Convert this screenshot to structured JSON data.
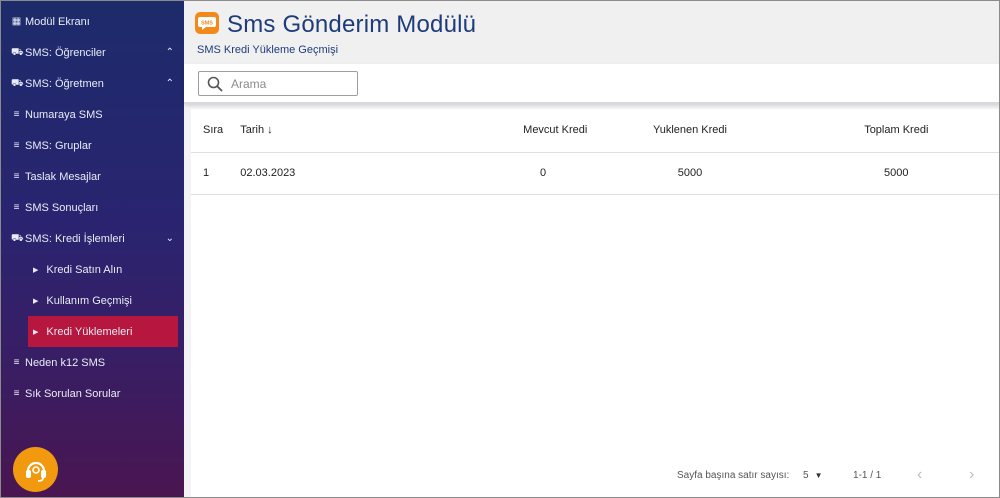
{
  "sidebar": {
    "items": [
      {
        "icon": "grid-icon",
        "glyph": "▦",
        "label": "Modül Ekranı"
      },
      {
        "icon": "truck-icon",
        "glyph": "⛟",
        "label": "SMS: Öğrenciler",
        "chevron": "⌃"
      },
      {
        "icon": "truck-icon",
        "glyph": "⛟",
        "label": "SMS: Öğretmen",
        "chevron": "⌃"
      },
      {
        "icon": "list-icon",
        "glyph": "≡",
        "label": "Numaraya SMS"
      },
      {
        "icon": "list-icon",
        "glyph": "≡",
        "label": "SMS: Gruplar"
      },
      {
        "icon": "list-icon",
        "glyph": "≡",
        "label": "Taslak Mesajlar"
      },
      {
        "icon": "list-icon",
        "glyph": "≡",
        "label": "SMS Sonuçları"
      },
      {
        "icon": "truck-icon",
        "glyph": "⛟",
        "label": "SMS: Kredi İşlemleri",
        "chevron": "⌄"
      }
    ],
    "subitems": [
      {
        "label": "Kredi Satın Alın"
      },
      {
        "label": "Kullanım Geçmişi"
      },
      {
        "label": "Kredi Yüklemeleri",
        "active": true
      }
    ],
    "bottom_items": [
      {
        "icon": "list-icon",
        "glyph": "≡",
        "label": "Neden k12 SMS"
      },
      {
        "icon": "list-icon",
        "glyph": "≡",
        "label": "Sık Sorulan Sorular"
      }
    ]
  },
  "header": {
    "logo_text": "SMS",
    "title": "Sms Gönderim Modülü",
    "subtitle": "SMS Kredi Yükleme Geçmişi"
  },
  "search": {
    "placeholder": "Arama",
    "value": ""
  },
  "table": {
    "columns": [
      "Sıra",
      "Tarih",
      "Mevcut Kredi",
      "Yuklenen Kredi",
      "Toplam Kredi"
    ],
    "sort_indicator": "↓",
    "rows": [
      {
        "sira": "1",
        "tarih": "02.03.2023",
        "mevcut": "0",
        "yuklenen": "5000",
        "toplam": "5000"
      }
    ]
  },
  "pagination": {
    "rows_per_page_label": "Sayfa başına satır sayısı:",
    "rows_per_page": "5",
    "range": "1-1 / 1",
    "prev": "‹",
    "next": "›"
  },
  "colors": {
    "sidebar_top": "#1d2b6b",
    "sidebar_bottom": "#4a1550",
    "active_item": "#b7173e",
    "title": "#1f3c7a",
    "support_button": "#f19a0f"
  }
}
